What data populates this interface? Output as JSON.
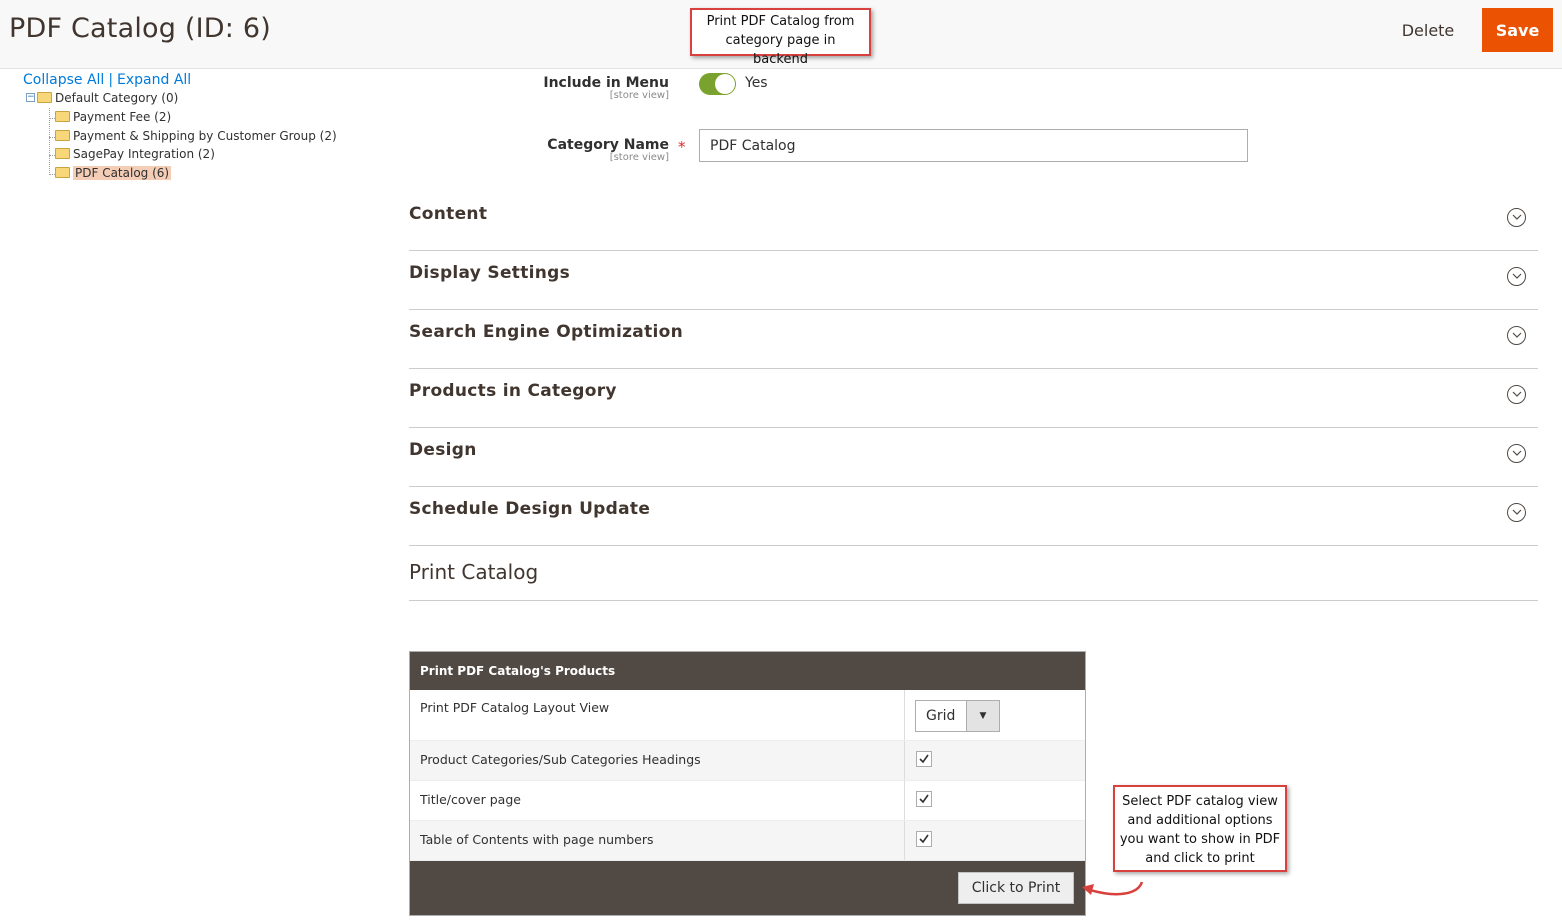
{
  "header": {
    "title": "PDF Catalog (ID: 6)",
    "delete_label": "Delete",
    "save_label": "Save"
  },
  "callouts": {
    "top_line1": "Print PDF Catalog from",
    "top_line2": "category page in backend",
    "bottom_line1": "Select PDF catalog view",
    "bottom_line2": "and additional options",
    "bottom_line3": "you want to show in PDF",
    "bottom_line4": "and click to print"
  },
  "tree": {
    "collapse_all": "Collapse All",
    "separator": "|",
    "expand_all": "Expand All",
    "root": "Default Category (0)",
    "children": [
      "Payment Fee (2)",
      "Payment & Shipping by Customer Group (2)",
      "SagePay Integration (2)",
      "PDF Catalog (6)"
    ]
  },
  "fields": {
    "include_in_menu": {
      "label": "Include in Menu",
      "scope": "[store view]",
      "value": "Yes"
    },
    "category_name": {
      "label": "Category Name",
      "scope": "[store view]",
      "required_mark": "*",
      "value": "PDF Catalog"
    }
  },
  "sections": [
    "Content",
    "Display Settings",
    "Search Engine Optimization",
    "Products in Category",
    "Design",
    "Schedule Design Update"
  ],
  "print_catalog": {
    "title": "Print Catalog",
    "table_header": "Print PDF Catalog's Products",
    "layout_label": "Print PDF Catalog Layout View",
    "layout_value": "Grid",
    "options": [
      {
        "label": "Product Categories/Sub Categories Headings",
        "checked": true
      },
      {
        "label": "Title/cover page",
        "checked": true
      },
      {
        "label": "Table of Contents with page numbers",
        "checked": true
      }
    ],
    "print_button": "Click to Print"
  },
  "colors": {
    "accent": "#eb5202",
    "toggle_on": "#79a22e",
    "panel_dark": "#514943",
    "callout_border": "#d9413f",
    "link": "#007bdb"
  }
}
